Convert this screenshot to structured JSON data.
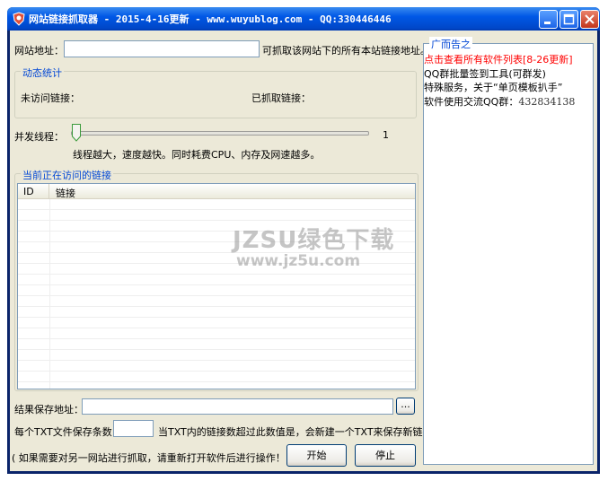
{
  "window": {
    "title": "网站链接抓取器 - 2015-4-16更新 - www.wuyublog.com - QQ:330446446"
  },
  "url_row": {
    "label": "网站地址：",
    "value": "",
    "hint": "可抓取该网站下的所有本站链接地址。"
  },
  "stats": {
    "legend": "动态统计",
    "unvisited_label": "未访问链接：",
    "fetched_label": "已抓取链接："
  },
  "threads": {
    "label": "并发线程：",
    "value": "1",
    "slider_fraction": 0,
    "note": "线程越大，速度越快。同时耗费CPU、内存及网速越多。"
  },
  "current": {
    "legend": "当前正在访问的链接",
    "columns": [
      "ID",
      "链接"
    ],
    "rows": []
  },
  "save": {
    "label": "结果保存地址：",
    "value": "",
    "browse_label": "..."
  },
  "txt": {
    "label": "每个TXT文件保存条数：",
    "value": "",
    "note": "当TXT内的链接数超过此数值是，会新建一个TXT来保存新链接。"
  },
  "footer": {
    "note": "( 如果需要对另一网站进行抓取，请重新打开软件后进行操作！ )",
    "start_label": "开始",
    "stop_label": "停止"
  },
  "ads": {
    "legend": "广而告之",
    "lines": [
      {
        "text": "点击查看所有软件列表[8-26更新]",
        "color": "#ff0000"
      },
      {
        "text": "QQ群批量签到工具(可群发)",
        "color": "#000000"
      },
      {
        "text": "特殊服务，关于“单页模板扒手”",
        "color": "#000000"
      }
    ],
    "qq_label": "软件使用交流QQ群：",
    "qq_number": "432834138"
  },
  "watermark": {
    "line1": "JZSU绿色下载",
    "line2": "www.jz5u.com"
  },
  "colors": {
    "title_bar": "#0058e6",
    "client_bg": "#ece9d8",
    "legend_blue": "#0046d5",
    "ad_red": "#ff0000"
  }
}
